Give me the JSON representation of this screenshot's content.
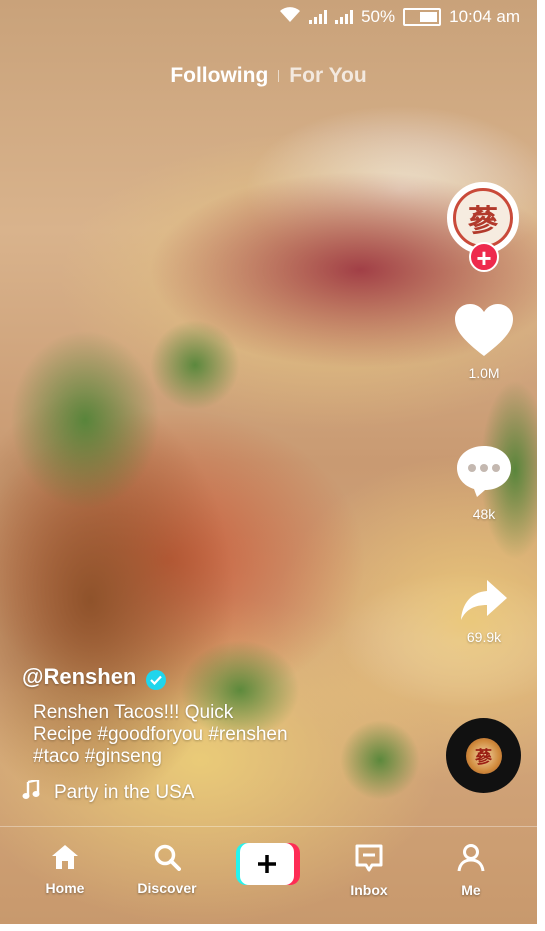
{
  "status_bar": {
    "battery": "50%",
    "time": "10:04 am",
    "icons": [
      "wifi-icon",
      "signal-icon",
      "signal-icon",
      "battery-icon"
    ]
  },
  "feed_tabs": {
    "following": "Following",
    "for_you": "For You"
  },
  "creator": {
    "avatar_glyph": "蔘"
  },
  "actions": {
    "likes": "1.0M",
    "comments": "48k",
    "shares": "69.9k"
  },
  "caption": {
    "username": "@Renshen",
    "description": "Renshen Tacos!!! Quick Recipe #goodforyou #renshen #taco #ginseng",
    "music": "Party in the USA"
  },
  "music_disc": {
    "glyph": "蔘"
  },
  "bottom_nav": {
    "home": "Home",
    "discover": "Discover",
    "inbox": "Inbox",
    "me": "Me"
  },
  "colors": {
    "accent_red": "#ee2a4d",
    "verified_blue": "#20d5ec",
    "create_cyan": "#25f4ee",
    "create_pink": "#fe2c55"
  }
}
